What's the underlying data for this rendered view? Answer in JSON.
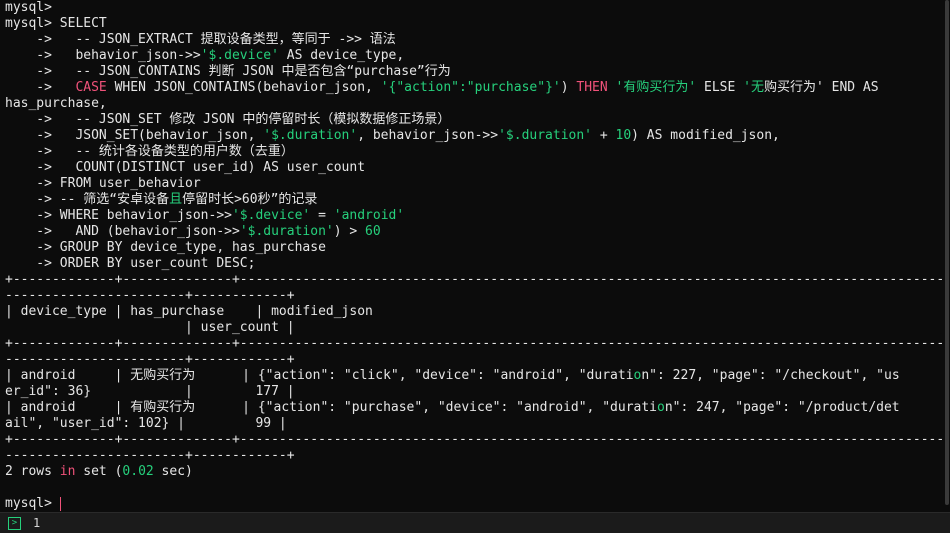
{
  "terminal": {
    "lines": [
      [
        {
          "t": "mysql>",
          "c": "default"
        }
      ],
      [
        {
          "t": "mysql> SELECT",
          "c": "default"
        }
      ],
      [
        {
          "t": "    ->   -- JSON_EXTRACT 提取设备类型，等同于 ->> 语法",
          "c": "default"
        }
      ],
      [
        {
          "t": "    ->   behavior_json->>",
          "c": "default"
        },
        {
          "t": "'$.device'",
          "c": "string"
        },
        {
          "t": " AS device_type,",
          "c": "default"
        }
      ],
      [
        {
          "t": "    ->   -- JSON_CONTAINS 判断 JSON 中是否包含“purchase”行为",
          "c": "default"
        }
      ],
      [
        {
          "t": "    ->   ",
          "c": "default"
        },
        {
          "t": "CASE",
          "c": "keyword"
        },
        {
          "t": " WHEN JSON_CONTAINS(behavior_json, ",
          "c": "default"
        },
        {
          "t": "'{\"action\":\"purchase\"}'",
          "c": "string"
        },
        {
          "t": ") ",
          "c": "default"
        },
        {
          "t": "THEN",
          "c": "keyword"
        },
        {
          "t": " ",
          "c": "default"
        },
        {
          "t": "'有购买行为'",
          "c": "string"
        },
        {
          "t": " ELSE ",
          "c": "default"
        },
        {
          "t": "'无",
          "c": "string"
        },
        {
          "t": "购买行为' END AS",
          "c": "default"
        }
      ],
      [
        {
          "t": "has_purchase,",
          "c": "default"
        }
      ],
      [
        {
          "t": "    ->   -- JSON_SET 修改 JSON 中的停留时长（模拟数据修正场景）",
          "c": "default"
        }
      ],
      [
        {
          "t": "    ->   JSON_SET(behavior_json, ",
          "c": "default"
        },
        {
          "t": "'$.duration'",
          "c": "string"
        },
        {
          "t": ", behavior_json->>",
          "c": "default"
        },
        {
          "t": "'$.duration'",
          "c": "string"
        },
        {
          "t": " + ",
          "c": "default"
        },
        {
          "t": "10",
          "c": "number"
        },
        {
          "t": ") AS modified_json,",
          "c": "default"
        }
      ],
      [
        {
          "t": "    ->   -- 统计各设备类型的用户数（去重）",
          "c": "default"
        }
      ],
      [
        {
          "t": "    ->   COUNT(DISTINCT user_id) AS user_count",
          "c": "default"
        }
      ],
      [
        {
          "t": "    -> FROM user_behavior",
          "c": "default"
        }
      ],
      [
        {
          "t": "    -> -- 筛选“安卓设备",
          "c": "default"
        },
        {
          "t": "且",
          "c": "string"
        },
        {
          "t": "停留时长>60秒”的记录",
          "c": "default"
        }
      ],
      [
        {
          "t": "    -> WHERE behavior_json->>",
          "c": "default"
        },
        {
          "t": "'$.device'",
          "c": "string"
        },
        {
          "t": " = ",
          "c": "default"
        },
        {
          "t": "'android'",
          "c": "string"
        }
      ],
      [
        {
          "t": "    ->   AND (behavior_json->>",
          "c": "default"
        },
        {
          "t": "'$.duration'",
          "c": "string"
        },
        {
          "t": ") > ",
          "c": "default"
        },
        {
          "t": "60",
          "c": "number"
        }
      ],
      [
        {
          "t": "    -> GROUP BY device_type, has_purchase",
          "c": "default"
        }
      ],
      [
        {
          "t": "    -> ORDER BY user_count DESC;",
          "c": "default"
        }
      ],
      [
        {
          "t": "+-------------+--------------+--------------------------------------------------------------------------------------------------",
          "c": "default"
        }
      ],
      [
        {
          "t": "-----------------------+------------+",
          "c": "default"
        }
      ],
      [
        {
          "t": "| device_type | has_purchase    | modified_json",
          "c": "default"
        }
      ],
      [
        {
          "t": "                       | user_count |",
          "c": "default"
        }
      ],
      [
        {
          "t": "+-------------+--------------+--------------------------------------------------------------------------------------------------",
          "c": "default"
        }
      ],
      [
        {
          "t": "-----------------------+------------+",
          "c": "default"
        }
      ],
      [
        {
          "t": "| android     | 无购买行为      | {\"action\": \"click\", \"device\": \"android\", \"durati",
          "c": "default"
        },
        {
          "t": "o",
          "c": "string"
        },
        {
          "t": "n\": 227, \"page\": \"/checkout\", \"us",
          "c": "default"
        }
      ],
      [
        {
          "t": "er_id\": 36}            |        177 |",
          "c": "default"
        }
      ],
      [
        {
          "t": "| android     | 有购买行为      | {\"action\": \"purchase\", \"device\": \"android\", \"durati",
          "c": "default"
        },
        {
          "t": "o",
          "c": "string"
        },
        {
          "t": "n\": 247, \"page\": \"/product/det",
          "c": "default"
        }
      ],
      [
        {
          "t": "ail\", \"user_id\": 102} |         99 |",
          "c": "default"
        }
      ],
      [
        {
          "t": "+-------------+--------------+--------------------------------------------------------------------------------------------------",
          "c": "default"
        }
      ],
      [
        {
          "t": "-----------------------+------------+",
          "c": "default"
        }
      ],
      [
        {
          "t": "2 rows ",
          "c": "default"
        },
        {
          "t": "in",
          "c": "keyword"
        },
        {
          "t": " set (",
          "c": "default"
        },
        {
          "t": "0.02",
          "c": "number"
        },
        {
          "t": " sec)",
          "c": "default"
        }
      ],
      [
        {
          "t": "",
          "c": "default"
        }
      ],
      [
        {
          "t": "mysql> ",
          "c": "default"
        }
      ]
    ]
  },
  "statusbar": {
    "icon": "terminal-prompt-icon",
    "count": "1"
  },
  "colors": {
    "background": "#0c0c0c",
    "text": "#e6e6e6",
    "string": "#26d07c",
    "keyword": "#f0527a"
  }
}
